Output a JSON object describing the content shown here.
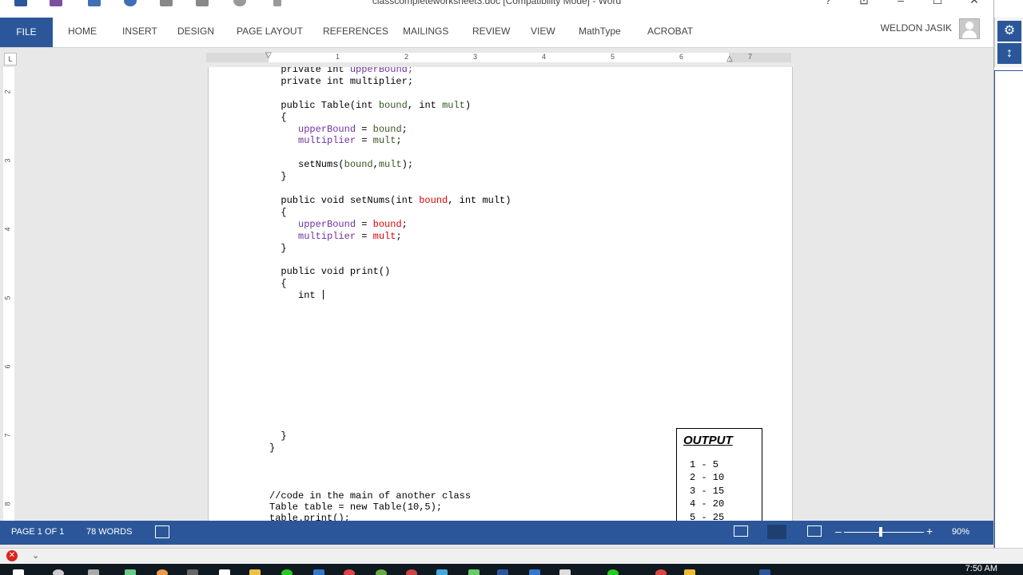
{
  "window": {
    "title": "classcompleteworksheet3.doc [Compatibility Mode] - Word",
    "controls": {
      "help": "?",
      "ribbon_display": "⊡",
      "minimize": "–",
      "maximize": "☐",
      "close": "✕"
    }
  },
  "ribbon": {
    "file": "FILE",
    "tabs": [
      "HOME",
      "INSERT",
      "DESIGN",
      "PAGE LAYOUT",
      "REFERENCES",
      "MAILINGS",
      "REVIEW",
      "VIEW",
      "MathType",
      "ACROBAT"
    ],
    "user": "WELDON JASIK"
  },
  "ruler": {
    "corner": "L",
    "h_numbers": [
      "1",
      "2",
      "3",
      "4",
      "5",
      "6",
      "7"
    ],
    "v_numbers": [
      "2",
      "3",
      "4",
      "5",
      "6",
      "7",
      "8"
    ]
  },
  "document": {
    "code_lines": [
      [
        {
          "t": "  private int ",
          "c": "kw"
        },
        {
          "t": "upperBound;",
          "c": "fld"
        }
      ],
      [
        {
          "t": "  private int multiplier;",
          "c": "kw"
        }
      ],
      [],
      [
        {
          "t": "  public Table(int ",
          "c": "kw"
        },
        {
          "t": "bound",
          "c": "param"
        },
        {
          "t": ", int ",
          "c": "kw"
        },
        {
          "t": "mult",
          "c": "param"
        },
        {
          "t": ")",
          "c": "kw"
        }
      ],
      [
        {
          "t": "  {",
          "c": "kw"
        }
      ],
      [
        {
          "t": "     ",
          "c": "kw"
        },
        {
          "t": "upperBound",
          "c": "fld"
        },
        {
          "t": " = ",
          "c": "kw"
        },
        {
          "t": "bound",
          "c": "param"
        },
        {
          "t": ";",
          "c": "kw"
        }
      ],
      [
        {
          "t": "     ",
          "c": "kw"
        },
        {
          "t": "multiplier",
          "c": "fld"
        },
        {
          "t": " = ",
          "c": "kw"
        },
        {
          "t": "mult",
          "c": "param"
        },
        {
          "t": ";",
          "c": "kw"
        }
      ],
      [],
      [
        {
          "t": "     setNums(",
          "c": "kw"
        },
        {
          "t": "bound",
          "c": "param"
        },
        {
          "t": ",",
          "c": "kw"
        },
        {
          "t": "mult",
          "c": "param"
        },
        {
          "t": ");",
          "c": "kw"
        }
      ],
      [
        {
          "t": "  }",
          "c": "kw"
        }
      ],
      [],
      [
        {
          "t": "  public void setNums(int ",
          "c": "kw"
        },
        {
          "t": "bound",
          "c": "red"
        },
        {
          "t": ", int mult)",
          "c": "kw"
        }
      ],
      [
        {
          "t": "  {",
          "c": "kw"
        }
      ],
      [
        {
          "t": "     ",
          "c": "kw"
        },
        {
          "t": "upperBound",
          "c": "fld"
        },
        {
          "t": " = ",
          "c": "kw"
        },
        {
          "t": "bound",
          "c": "red"
        },
        {
          "t": ";",
          "c": "kw"
        }
      ],
      [
        {
          "t": "     ",
          "c": "kw"
        },
        {
          "t": "multiplier",
          "c": "fld"
        },
        {
          "t": " = ",
          "c": "kw"
        },
        {
          "t": "mult",
          "c": "red"
        },
        {
          "t": ";",
          "c": "kw"
        }
      ],
      [
        {
          "t": "  }",
          "c": "kw"
        }
      ],
      [],
      [
        {
          "t": "  public void print()",
          "c": "kw"
        }
      ],
      [
        {
          "t": "  {",
          "c": "kw"
        }
      ],
      [
        {
          "t": "     int ",
          "c": "kw"
        }
      ]
    ],
    "closing_lines": [
      "  }",
      "}"
    ],
    "main_lines": [
      "//code in the main of another class",
      "Table table = new Table(10,5);",
      "table.print();"
    ],
    "output": {
      "title": "OUTPUT",
      "lines": [
        "1 - 5",
        "2 - 10",
        "3 - 15",
        "4 - 20",
        "5 - 25"
      ]
    }
  },
  "status": {
    "page": "PAGE 1 OF 1",
    "words": "78 WORDS",
    "zoom": "90%",
    "zoom_minus": "–",
    "zoom_plus": "+"
  },
  "taskbar": {
    "time": "7:50 AM"
  }
}
